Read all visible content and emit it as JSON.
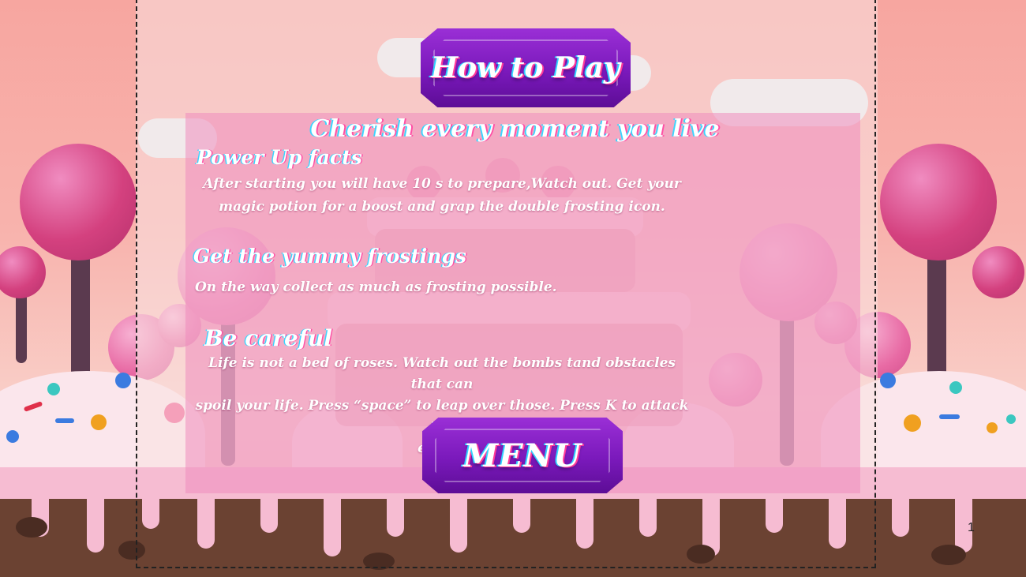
{
  "title_button": {
    "label": "How to Play"
  },
  "headline": "Cherish every moment you live",
  "sections": [
    {
      "heading": "Power Up facts",
      "lines": [
        "After starting you will have 10 s to prepare,Watch out. Get your",
        "magic potion for a boost and grap the double frosting icon."
      ]
    },
    {
      "heading": "Get the yummy frostings",
      "lines": [
        "On the way collect as much as frosting possible."
      ]
    },
    {
      "heading": "Be careful",
      "lines": [
        "Life is not a bed of roses. Watch out the bombs tand obstacles that can",
        "spoil your life. Press  “space” to leap over those. Press K to attack the",
        "enemy"
      ]
    }
  ],
  "menu_button": {
    "label": "MENU"
  },
  "page_number": "1",
  "colors": {
    "button_purple": "#7a19bb",
    "panel_pink": "#ee8cbe",
    "glow_cyan": "#3bd5ff",
    "glow_pink": "#ff4fa5"
  }
}
